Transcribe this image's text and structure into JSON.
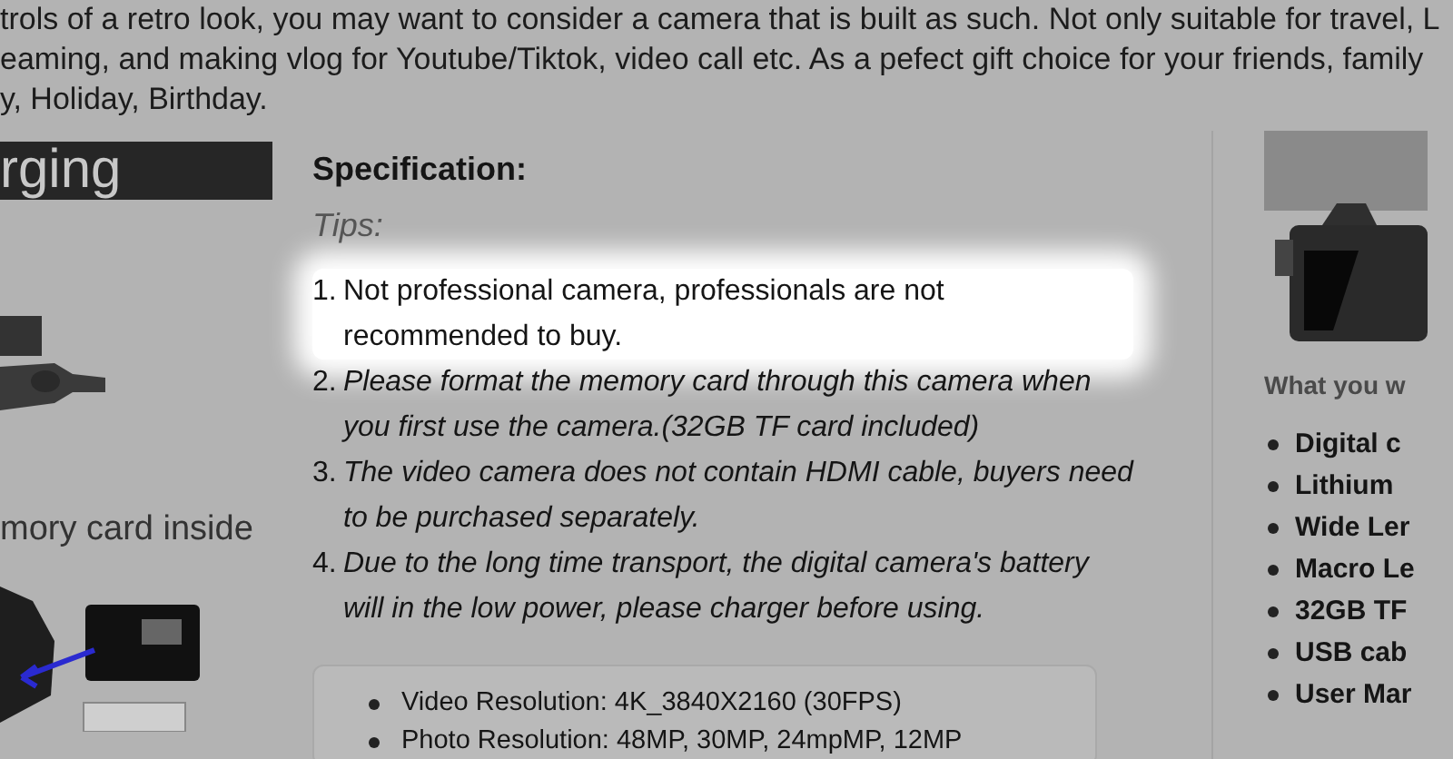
{
  "description_lines": [
    "trols of a retro look, you may want to consider a camera that is built as such. Not only suitable for travel, L",
    "eaming, and making vlog for Youtube/Tiktok, video call etc. As a pefect gift choice for your friends, family",
    "y, Holiday, Birthday."
  ],
  "left_image": {
    "banner": "rging",
    "caption": "mory card inside"
  },
  "specification": {
    "title": "Specification:",
    "subtitle": "Tips:",
    "tips": [
      {
        "number": "1.",
        "text": "Not professional camera, professionals are not recommended to buy.",
        "highlighted": true
      },
      {
        "number": "2.",
        "text": "Please format the memory card through this camera when you first use the camera.(32GB TF card included)",
        "highlighted": false
      },
      {
        "number": "3.",
        "text": "The video camera does not contain HDMI cable, buyers need to be purchased separately.",
        "highlighted": false
      },
      {
        "number": "4.",
        "text": "Due to the long time transport, the digital camera's battery will in the low power, please charger before using.",
        "highlighted": false
      }
    ],
    "specs": [
      "Video Resolution: 4K_3840X2160 (30FPS)",
      "Photo Resolution: 48MP, 30MP, 24mpMP, 12MP"
    ]
  },
  "package": {
    "heading": "What you w",
    "items": [
      "Digital c",
      "Lithium",
      "Wide Ler",
      "Macro Le",
      "32GB TF",
      "USB cab",
      "User Mar"
    ]
  }
}
